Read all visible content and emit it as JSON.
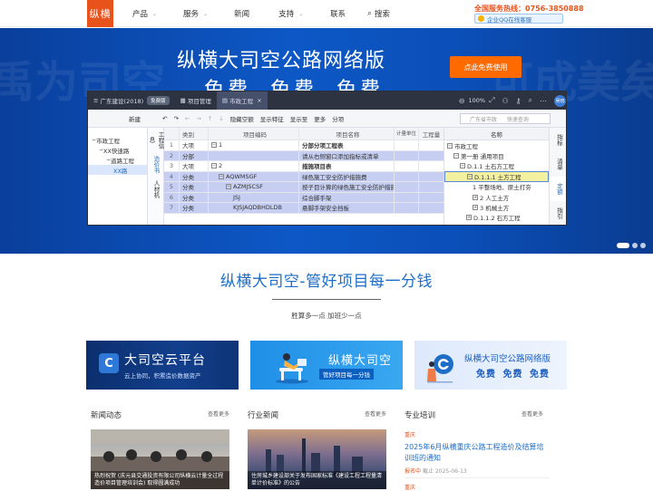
{
  "header": {
    "logo": "纵横",
    "nav": [
      {
        "label": "产品",
        "has_menu": true
      },
      {
        "label": "服务",
        "has_menu": true
      },
      {
        "label": "新闻",
        "has_menu": false
      },
      {
        "label": "支持",
        "has_menu": true
      },
      {
        "label": "联系",
        "has_menu": false
      }
    ],
    "search_label": "搜索",
    "hotline_label": "全国服务热线：",
    "hotline_number": "0756-3850888",
    "qq_label": "企业QQ在线客服"
  },
  "banner": {
    "title": "纵横大司空公路网络版",
    "subtitle": "免费 免费 免费",
    "cta": "点此免费使用",
    "watermark_left": "禹为司空",
    "watermark_right": "可成美矣",
    "slides": 3,
    "active_slide": 0
  },
  "app": {
    "title": "广东建设(2018)",
    "badge": "免费版",
    "tab_project": "项目管理",
    "tab_active": "市政工程",
    "zoom": "100%",
    "user": "吴晓",
    "toolbar": {
      "new": "新建",
      "hide_empty": "隐藏空额",
      "show_feature": "显示特征",
      "show_to": "显示至",
      "more": "更多",
      "split": "分项",
      "region": "广东省市政",
      "search_placeholder": "快速查询"
    },
    "left_tree": [
      {
        "label": "市政工程",
        "level": 0
      },
      {
        "label": "XX快速路",
        "level": 1
      },
      {
        "label": "道路工程",
        "level": 2
      },
      {
        "label": "XX路",
        "level": 3
      }
    ],
    "vertical_tabs": [
      "工程信息",
      "造价书",
      "人材机"
    ],
    "columns": [
      "类别",
      "项目编码",
      "项目名称",
      "计量单位",
      "工程量"
    ],
    "rows": [
      {
        "n": "1",
        "type": "大项",
        "code": "1",
        "name": "分部分项工程表",
        "bold": true,
        "indent": 0,
        "box": "−",
        "sel": false
      },
      {
        "n": "2",
        "type": "分部",
        "code": "",
        "name": "请从右侧窗口添加指标或清单",
        "bold": false,
        "indent": 0,
        "box": "",
        "sel": true
      },
      {
        "n": "3",
        "type": "大项",
        "code": "2",
        "name": "措施项目表",
        "bold": true,
        "indent": 0,
        "box": "−",
        "sel": false
      },
      {
        "n": "4",
        "type": "分类",
        "code": "AQWMSGF",
        "name": "绿色施工安全防护措施费",
        "bold": false,
        "indent": 1,
        "box": "−",
        "sel": true
      },
      {
        "n": "5",
        "type": "分类",
        "code": "AZMJSCSF",
        "name": "按子目计算的绿色施工安全防护措施费",
        "bold": false,
        "indent": 2,
        "box": "−",
        "sel": true
      },
      {
        "n": "6",
        "type": "分类",
        "code": "JSJ",
        "name": "综合脚手架",
        "bold": false,
        "indent": 3,
        "box": "",
        "sel": true
      },
      {
        "n": "7",
        "type": "分类",
        "code": "KJSJAQDBHDLDB",
        "name": "悬脚手架安全挡板",
        "bold": false,
        "indent": 3,
        "box": "",
        "sel": true
      }
    ],
    "right_header": "名称",
    "right_tree": [
      {
        "label": "市政工程",
        "box": "−",
        "indent": 0,
        "sel": false
      },
      {
        "label": "第一册 通用项目",
        "box": "−",
        "indent": 1,
        "sel": false
      },
      {
        "label": "D.1.1 土石方工程",
        "box": "−",
        "indent": 2,
        "sel": false
      },
      {
        "label": "D.1.1.1 土方工程",
        "box": "−",
        "indent": 3,
        "sel": true
      },
      {
        "label": "1 平整场地、原土打夯",
        "box": "",
        "indent": 4,
        "sel": false
      },
      {
        "label": "2 人工土方",
        "box": "+",
        "indent": 4,
        "sel": false
      },
      {
        "label": "3 机械土方",
        "box": "+",
        "indent": 4,
        "sel": false
      },
      {
        "label": "D.1.1.2 石方工程",
        "box": "+",
        "indent": 3,
        "sel": false
      }
    ],
    "right_side_tabs": [
      "指标",
      "清单",
      "定额",
      "指引"
    ]
  },
  "slogan": {
    "title": "纵横大司空-管好项目每一分钱",
    "subtitle": "胜算多一点 加班少一点"
  },
  "cards": [
    {
      "title": "大司空云平台",
      "subtitle": "云上协同，积累造价数据资产"
    },
    {
      "title": "纵横大司空",
      "subtitle": "管好项目每一分钱"
    },
    {
      "title": "纵横大司空公路网络版",
      "subtitle": "免费 免费 免费"
    }
  ],
  "news": {
    "sections": [
      {
        "title": "新闻动态",
        "more": "查看更多"
      },
      {
        "title": "行业新闻",
        "more": "查看更多"
      },
      {
        "title": "专业培训",
        "more": "查看更多"
      }
    ],
    "news_caption": "热烈祝贺 (庆元县交通投资有限公司纵横云计量全过程造价项目管理培训会) 取得圆满成功",
    "industry_caption": "住房城乡建设部关于发布国家标准《建设工程工程量清单计价标准》的公告",
    "training": {
      "tag": "重庆",
      "title": "2025年6月纵横重庆公路工程造价及结算培训班的通知",
      "status": "报名中",
      "deadline": "截止 2025-06-13",
      "tag2": "重庆"
    }
  },
  "colors": {
    "brand": "#e8531c",
    "primary": "#1e6ec8",
    "banner": "#0d58c6",
    "cta": "#ff6a00"
  }
}
